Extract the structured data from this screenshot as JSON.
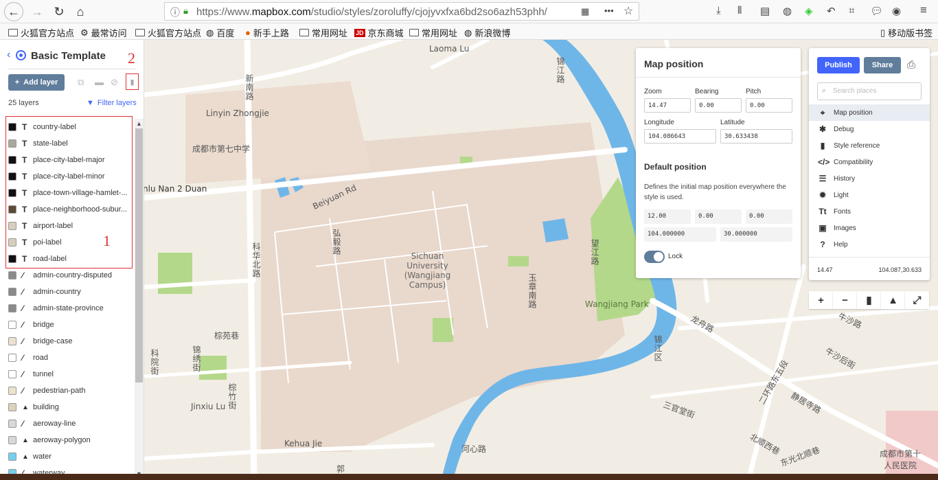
{
  "browser": {
    "url_prefix": "https://www.",
    "url_domain": "mapbox.com",
    "url_path": "/studio/styles/zoroluffy/cjojyvxfxa6bd2so6azh53phh/",
    "more": "•••",
    "bookmarks": [
      "火狐官方站点",
      "最常访问",
      "火狐官方站点",
      "百度",
      "新手上路",
      "常用网址",
      "京东商城",
      "常用网址",
      "新浪微博"
    ],
    "mobile_bookmarks": "移动版书签"
  },
  "left_panel": {
    "title": "Basic Template",
    "add_layer": "Add layer",
    "layers_count": "25 layers",
    "filter": "Filter layers",
    "annotation_1": "1",
    "annotation_2": "2",
    "layers": [
      {
        "type": "T",
        "name": "country-label",
        "color": "#111111"
      },
      {
        "type": "T",
        "name": "state-label",
        "color": "#a8a8a0"
      },
      {
        "type": "T",
        "name": "place-city-label-major",
        "color": "#111111"
      },
      {
        "type": "T",
        "name": "place-city-label-minor",
        "color": "#111111"
      },
      {
        "type": "T",
        "name": "place-town-village-hamlet-...",
        "color": "#111111"
      },
      {
        "type": "T",
        "name": "place-neighborhood-subur...",
        "color": "#5b4a36"
      },
      {
        "type": "T",
        "name": "airport-label",
        "color": "#d6cfbf"
      },
      {
        "type": "T",
        "name": "poi-label",
        "color": "#d6cfbf"
      },
      {
        "type": "T",
        "name": "road-label",
        "color": "#111111"
      },
      {
        "type": "line",
        "name": "admin-country-disputed",
        "color": "#8a8a8a"
      },
      {
        "type": "line",
        "name": "admin-country",
        "color": "#8a8a8a"
      },
      {
        "type": "line",
        "name": "admin-state-province",
        "color": "#8a8a8a"
      },
      {
        "type": "line",
        "name": "bridge",
        "color": "#ffffff"
      },
      {
        "type": "line",
        "name": "bridge-case",
        "color": "#ece3cf"
      },
      {
        "type": "line",
        "name": "road",
        "color": "#ffffff"
      },
      {
        "type": "line",
        "name": "tunnel",
        "color": "#ffffff"
      },
      {
        "type": "line",
        "name": "pedestrian-path",
        "color": "#ece3cf"
      },
      {
        "type": "fill",
        "name": "building",
        "color": "#dcd3bd"
      },
      {
        "type": "line",
        "name": "aeroway-line",
        "color": "#d8d8d8"
      },
      {
        "type": "fill",
        "name": "aeroway-polygon",
        "color": "#d8d8d8"
      },
      {
        "type": "fill",
        "name": "water",
        "color": "#75cff0"
      },
      {
        "type": "line",
        "name": "waterway",
        "color": "#75cff0"
      }
    ]
  },
  "map_position": {
    "title": "Map position",
    "zoom_label": "Zoom",
    "zoom": "14.47",
    "bearing_label": "Bearing",
    "bearing": "0.00",
    "pitch_label": "Pitch",
    "pitch": "0.00",
    "longitude_label": "Longitude",
    "longitude": "104.086643",
    "latitude_label": "Latitude",
    "latitude": "30.633438",
    "default_title": "Default position",
    "default_desc": "Defines the initial map position everywhere the style is used.",
    "default_zoom": "12.00",
    "default_bearing": "0.00",
    "default_pitch": "0.00",
    "default_lon": "104.000000",
    "default_lat": "30.000000",
    "lock_label": "Lock"
  },
  "right_panel": {
    "publish": "Publish",
    "share": "Share",
    "search_placeholder": "Search places",
    "menu": [
      {
        "icon": "⌖",
        "label": "Map position"
      },
      {
        "icon": "✱",
        "label": "Debug"
      },
      {
        "icon": "▮",
        "label": "Style reference"
      },
      {
        "icon": "</>",
        "label": "Compatibility"
      },
      {
        "icon": "☰",
        "label": "History"
      },
      {
        "icon": "✹",
        "label": "Light"
      },
      {
        "icon": "Tt",
        "label": "Fonts"
      },
      {
        "icon": "▣",
        "label": "Images"
      },
      {
        "icon": "?",
        "label": "Help"
      }
    ],
    "footer_zoom": "14.47",
    "footer_coords": "104.087,30.633"
  },
  "map_labels": [
    "Laoma Lu",
    "新南路",
    "Linyin Zhongjie",
    "成都市第七中学",
    "nlu Nan 2 Duan",
    "Beiyuan Rd",
    "弘毅路",
    "Sichuan University (Wangjiang Campus)",
    "科华北路",
    "玉章南路",
    "望江路",
    "Wangjiang Park",
    "锦江路",
    "棕苑巷",
    "科院街",
    "锦绣街",
    "棕竹街",
    "Jinxiu Lu",
    "Kehua Jie",
    "河心路",
    "龙舟路",
    "牛沙路",
    "牛沙后街",
    "二环路东五段",
    "锦江区",
    "三官堂街",
    "静居寺路",
    "北顺西巷",
    "东光北顺巷",
    "成都市第十人民医院",
    "郭"
  ]
}
